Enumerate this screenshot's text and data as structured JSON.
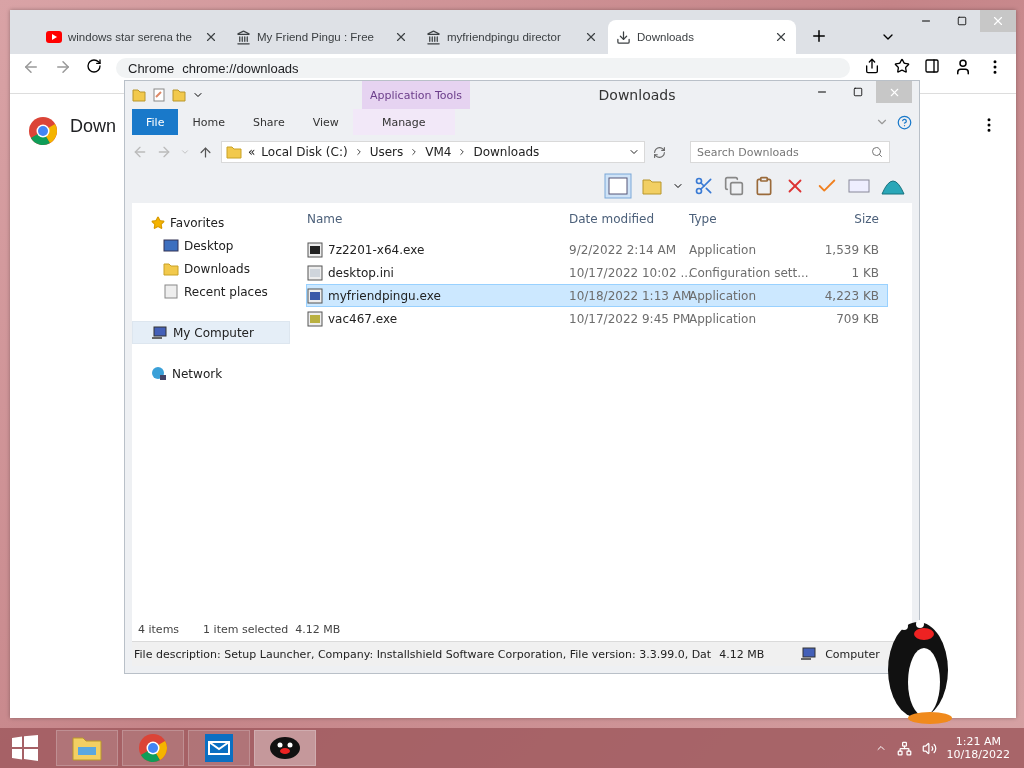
{
  "browser": {
    "tabs": [
      {
        "title": "windows star serena the",
        "kind": "video",
        "selected": false
      },
      {
        "title": "My Friend Pingu : Free",
        "kind": "library",
        "selected": false
      },
      {
        "title": "myfriendpingu director",
        "kind": "library",
        "selected": false
      },
      {
        "title": "Downloads",
        "kind": "download",
        "selected": true
      }
    ],
    "omnibox": {
      "site": "Chrome",
      "url": "chrome://downloads"
    },
    "page_title": "Down"
  },
  "explorer": {
    "title": "Downloads",
    "context_tab": "Application Tools",
    "ribbon_tabs": [
      {
        "label": "File",
        "kind": "file"
      },
      {
        "label": "Home",
        "kind": "tab"
      },
      {
        "label": "Share",
        "kind": "tab"
      },
      {
        "label": "View",
        "kind": "tab"
      },
      {
        "label": "Manage",
        "kind": "context"
      }
    ],
    "path_overflow": "«",
    "path": [
      "Local Disk (C:)",
      "Users",
      "VM4",
      "Downloads"
    ],
    "search": {
      "placeholder": "Search Downloads"
    },
    "nav": [
      {
        "label": "Favorites",
        "kind": "star",
        "selected": false,
        "children": [
          {
            "label": "Desktop",
            "kind": "desktop",
            "selected": false
          },
          {
            "label": "Downloads",
            "kind": "folder",
            "selected": false
          },
          {
            "label": "Recent places",
            "kind": "recent",
            "selected": false
          }
        ]
      },
      {
        "label": "My Computer",
        "kind": "computer",
        "selected": true
      },
      {
        "label": "Network",
        "kind": "network",
        "selected": false
      }
    ],
    "columns": [
      "Name",
      "Date modified",
      "Type",
      "Size"
    ],
    "files": [
      {
        "name": "7z2201-x64.exe",
        "date": "9/2/2022 2:14 AM",
        "type": "Application",
        "size": "1,539 KB",
        "kind": "archiver",
        "selected": false
      },
      {
        "name": "desktop.ini",
        "date": "10/17/2022 10:02 ...",
        "type": "Configuration sett...",
        "size": "1 KB",
        "kind": "settings",
        "selected": false
      },
      {
        "name": "myfriendpingu.exe",
        "date": "10/18/2022 1:13 AM",
        "type": "Application",
        "size": "4,223 KB",
        "kind": "installer",
        "selected": true
      },
      {
        "name": "vac467.exe",
        "date": "10/17/2022 9:45 PM",
        "type": "Application",
        "size": "709 KB",
        "kind": "program",
        "selected": false
      }
    ],
    "status": {
      "count": "4 items",
      "selection": "1 item selected  4.12 MB"
    },
    "details_bar": {
      "description": "File description: Setup Launcher, Company: Installshield Software Corporation, File version: 3.3.99.0, Dat",
      "size": "4.12 MB",
      "location": "Computer"
    }
  },
  "taskbar": {
    "apps": [
      {
        "kind": "explorer",
        "selected": false
      },
      {
        "kind": "chrome",
        "selected": false
      },
      {
        "kind": "mail",
        "selected": false
      },
      {
        "kind": "pingu",
        "selected": true
      }
    ],
    "time": "1:21 AM",
    "date": "10/18/2022"
  }
}
